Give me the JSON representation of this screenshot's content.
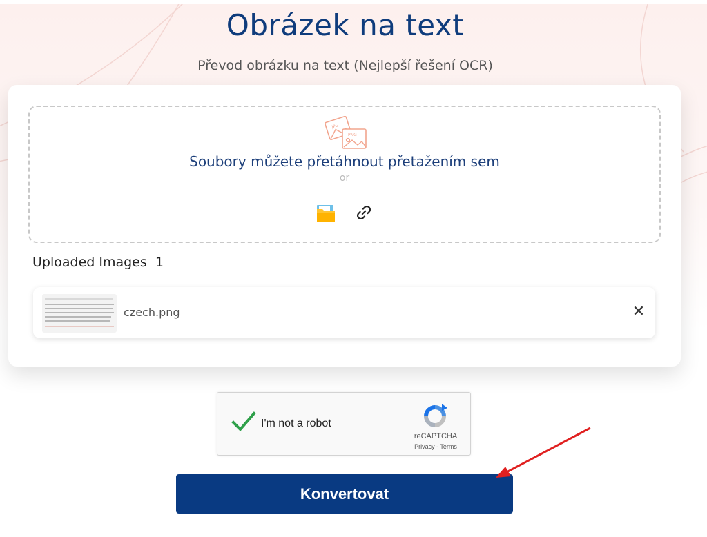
{
  "header": {
    "title": "Obrázek na text",
    "subtitle": "Převod obrázku na text (Nejlepší řešení OCR)"
  },
  "dropzone": {
    "icon": "image-files-icon",
    "text": "Soubory můžete přetáhnout přetažením sem",
    "or_text": "or",
    "folder_icon": "folder-icon",
    "link_icon": "link-icon"
  },
  "uploads": {
    "title": "Uploaded Images",
    "count": "1",
    "files": [
      {
        "name": "czech.png",
        "remove_icon": "close-icon"
      }
    ]
  },
  "recaptcha": {
    "label": "I'm not a robot",
    "brand": "reCAPTCHA",
    "links": "Privacy - Terms",
    "checked": true
  },
  "actions": {
    "convert_label": "Konvertovat"
  },
  "colors": {
    "primary": "#093a82",
    "title": "#0f3c7c",
    "check": "#2fa04a",
    "annotation_arrow": "#e02020"
  }
}
